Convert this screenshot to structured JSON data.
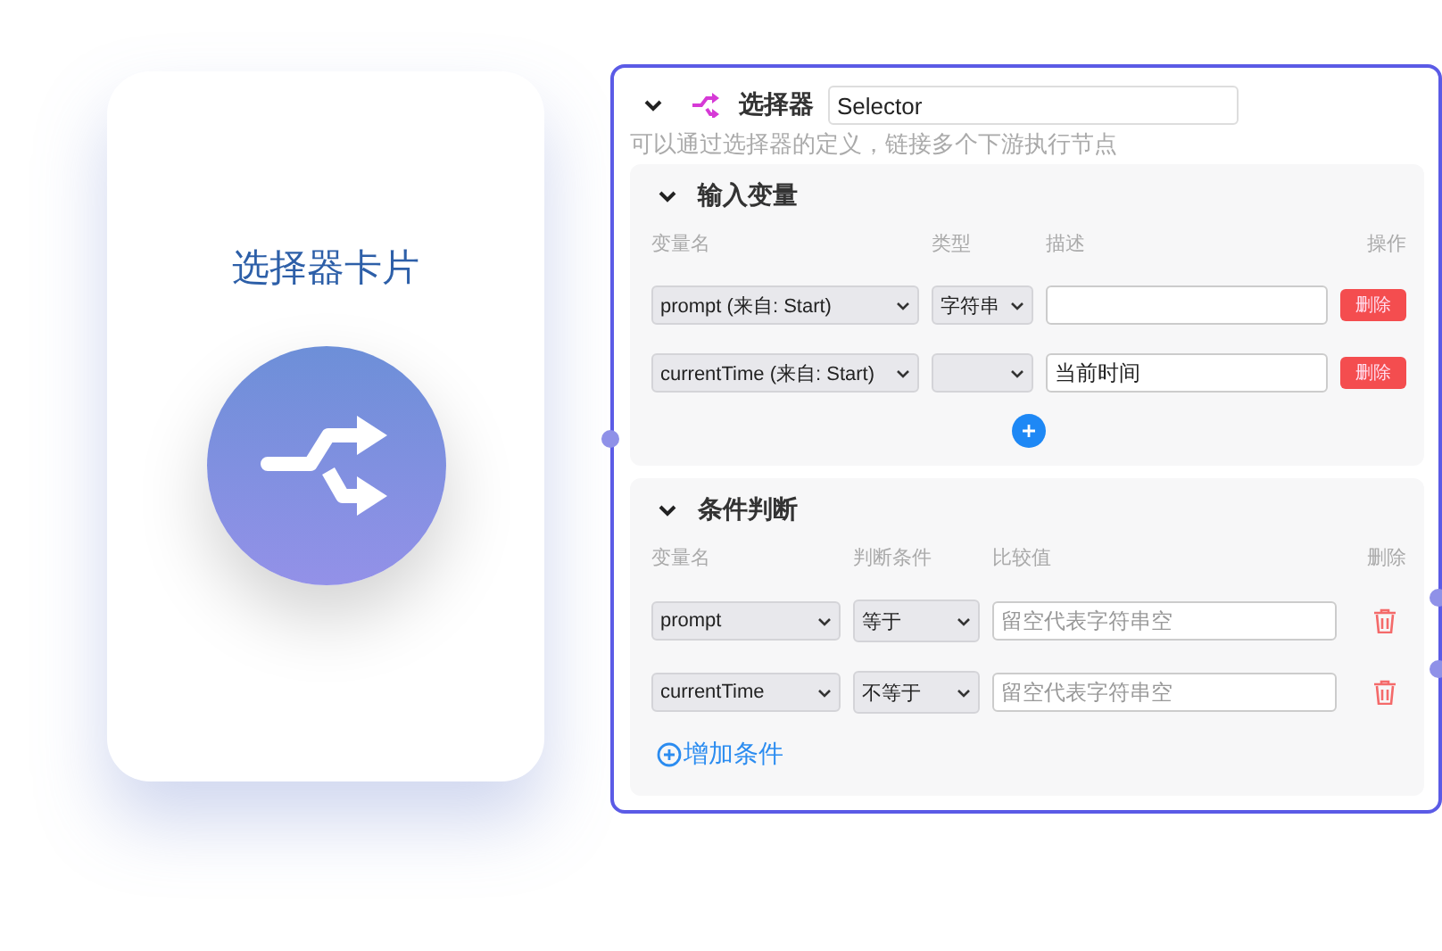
{
  "card": {
    "title": "选择器卡片"
  },
  "node": {
    "expanded": true,
    "title": "选择器",
    "name_value": "Selector",
    "description": "可以通过选择器的定义，链接多个下游执行节点",
    "input_section": {
      "title": "输入变量",
      "expanded": true,
      "columns": [
        "变量名",
        "类型",
        "描述",
        "操作"
      ],
      "rows": [
        {
          "variable": "prompt (来自: Start)",
          "type": "字符串",
          "action": "删除"
        },
        {
          "variable": "currentTime (来自: Start)",
          "description": "当前时间",
          "action": "删除"
        }
      ]
    },
    "condition_section": {
      "title": "条件判断",
      "expanded": true,
      "columns": [
        "变量名",
        "判断条件",
        "比较值",
        "删除"
      ],
      "rows": [
        {
          "variable": "prompt",
          "operator": "等于",
          "value_placeholder": "留空代表字符串空"
        },
        {
          "variable": "currentTime",
          "operator": "不等于",
          "value_placeholder": "留空代表字符串空"
        }
      ],
      "add_label": "增加条件"
    }
  }
}
